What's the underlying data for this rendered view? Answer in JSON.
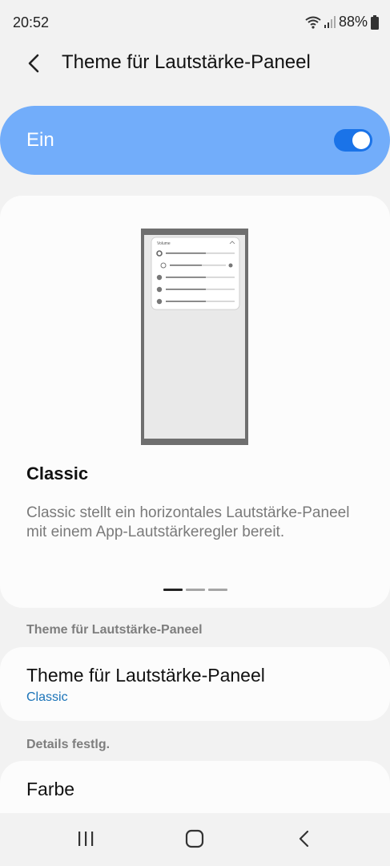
{
  "status_bar": {
    "time": "20:52",
    "battery": "88%",
    "icons": [
      "wifi-icon",
      "signal-icon",
      "battery-icon"
    ]
  },
  "header": {
    "title": "Theme für Lautstärke-Paneel",
    "back_icon": "back-arrow-icon"
  },
  "master_switch": {
    "label": "Ein",
    "state": true
  },
  "preview": {
    "mini_panel_title": "Volume",
    "theme_name": "Classic",
    "description": "Classic stellt ein horizontales Lautstärke-Paneel mit einem App-Lautstärkeregler bereit.",
    "pages": 3,
    "active_page": 1
  },
  "sections": {
    "theme_header": "Theme für Lautstärke-Paneel",
    "details_header": "Details festlg."
  },
  "theme_item": {
    "title": "Theme für Lautstärke-Paneel",
    "value": "Classic"
  },
  "color_item": {
    "title": "Farbe"
  },
  "nav_bar": {
    "buttons": [
      "recents-icon",
      "home-icon",
      "back-icon"
    ]
  },
  "colors": {
    "background": "#f2f2f2",
    "card": "#fcfcfc",
    "toggle_bar": "#72adfa",
    "switch_on": "#1a73e8",
    "accent_text": "#1a73b8"
  }
}
